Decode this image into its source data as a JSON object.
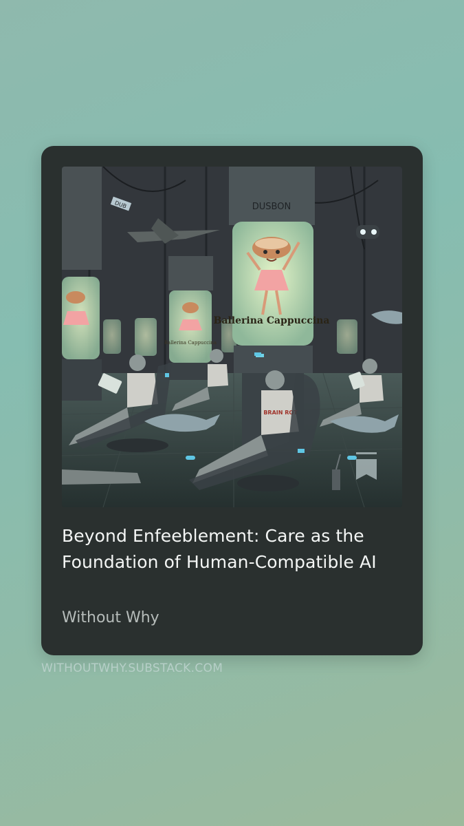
{
  "card": {
    "title": "Beyond Enfeeblement: Care as the Foundation of Human-Compatible AI",
    "publication": "Without Why",
    "domain": "WITHOUTWHY.SUBSTACK.COM"
  },
  "image": {
    "pod_text_main": "Ballerina Cappuccina",
    "pod_text_small": "Ballerina Cappuccina",
    "shirt_text": "BRAIN ROT",
    "brand_text": "DUSBON",
    "drone_text": "DUB"
  },
  "colors": {
    "background": "#8fb9ad",
    "card": "#2a302f",
    "title": "#f4f6f5",
    "publication": "#b6bcba",
    "domain": "#b7cfc8"
  }
}
